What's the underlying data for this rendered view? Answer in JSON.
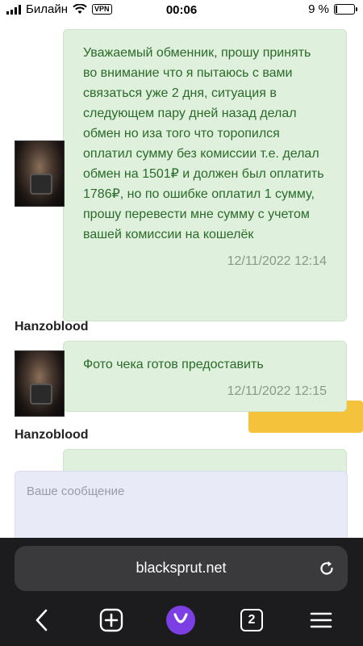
{
  "status": {
    "carrier": "Билайн",
    "vpn": "VPN",
    "time": "00:06",
    "battery": "9 %",
    "battery_level": 0.09
  },
  "messages": [
    {
      "text": "Уважаемый обменник, прошу принять во внимание что я пытаюсь с вами связаться уже 2 дня, ситуация в следующем пару дней назад делал обмен но иза того что торопился оплатил сумму без комиссии т.е. делал обмен на 1501₽ и должен был оплатить 1786₽, но по ошибке оплатил 1 сумму, прошу перевести мне сумму с учетом вашей комиссии на кошелёк",
      "timestamp": "12/11/2022 12:14"
    },
    {
      "username": "Hanzoblood",
      "text": "Фото чека готов предоставить",
      "timestamp": "12/11/2022 12:15"
    },
    {
      "username": "Hanzoblood"
    }
  ],
  "input": {
    "placeholder": "Ваше сообщение"
  },
  "browser": {
    "url": "blacksprut.net",
    "tabs_count": "2"
  },
  "colors": {
    "bubble_bg": "#dff0dc",
    "bubble_text": "#2a6b2a",
    "accent_yellow": "#f5c33b",
    "alice_purple": "#7b3fe4"
  }
}
